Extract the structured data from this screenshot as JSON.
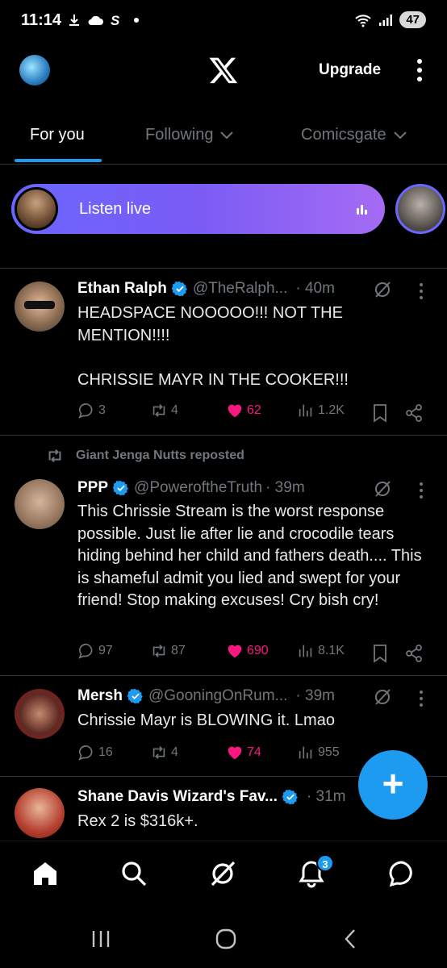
{
  "status_bar": {
    "time": "11:14",
    "battery": "47"
  },
  "header": {
    "upgrade_label": "Upgrade"
  },
  "tabs": [
    {
      "label": "For you",
      "active": true
    },
    {
      "label": "Following",
      "active": false
    },
    {
      "label": "Comicsgate",
      "active": false
    }
  ],
  "spaces": {
    "listen_label": "Listen live"
  },
  "tweets": [
    {
      "name": "Ethan Ralph",
      "handle": "@TheRalph...",
      "time": "· 40m",
      "text": "HEADSPACE NOOOOO!!! NOT THE MENTION!!!!\n\nCHRISSIE MAYR IN THE COOKER!!!",
      "replies": "3",
      "reposts": "4",
      "likes": "62",
      "views": "1.2K"
    },
    {
      "repost_by": "Giant Jenga Nutts reposted",
      "name": "PPP",
      "handle": "@PoweroftheTruth",
      "time": "· 39m",
      "text": "This Chrissie Stream is the worst response possible. Just lie after lie and crocodile tears hiding behind her child and fathers death.... This is shameful admit you lied and swept for your friend! Stop making excuses! Cry bish cry!",
      "replies": "97",
      "reposts": "87",
      "likes": "690",
      "views": "8.1K"
    },
    {
      "name": "Mersh",
      "handle": "@GooningOnRum...",
      "time": "· 39m",
      "text": "Chrissie Mayr is BLOWING it. Lmao",
      "replies": "16",
      "reposts": "4",
      "likes": "74",
      "views": "955"
    },
    {
      "name": "Shane Davis Wizard's Fav...",
      "handle": "",
      "time": "· 31m",
      "text": "Rex 2 is $316k+."
    }
  ],
  "bottom_nav": {
    "notifications_badge": "3"
  },
  "fab": {
    "label": "+"
  },
  "colors": {
    "accent": "#1d9bf0",
    "like": "#f91880",
    "muted": "#71767b"
  }
}
